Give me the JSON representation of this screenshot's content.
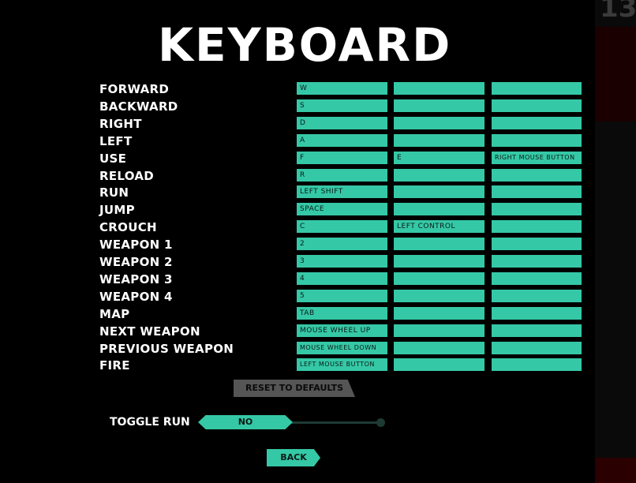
{
  "title": "KEYBOARD",
  "bindings": [
    {
      "action": "FORWARD",
      "keys": [
        "W",
        "",
        ""
      ]
    },
    {
      "action": "BACKWARD",
      "keys": [
        "S",
        "",
        ""
      ]
    },
    {
      "action": "RIGHT",
      "keys": [
        "D",
        "",
        ""
      ]
    },
    {
      "action": "LEFT",
      "keys": [
        "A",
        "",
        ""
      ]
    },
    {
      "action": "USE",
      "keys": [
        "F",
        "E",
        "RIGHT MOUSE BUTTON"
      ]
    },
    {
      "action": "RELOAD",
      "keys": [
        "R",
        "",
        ""
      ]
    },
    {
      "action": "RUN",
      "keys": [
        "LEFT SHIFT",
        "",
        ""
      ]
    },
    {
      "action": "JUMP",
      "keys": [
        "SPACE",
        "",
        ""
      ]
    },
    {
      "action": "CROUCH",
      "keys": [
        "C",
        "LEFT CONTROL",
        ""
      ]
    },
    {
      "action": "WEAPON 1",
      "keys": [
        "2",
        "",
        ""
      ]
    },
    {
      "action": "WEAPON 2",
      "keys": [
        "3",
        "",
        ""
      ]
    },
    {
      "action": "WEAPON 3",
      "keys": [
        "4",
        "",
        ""
      ]
    },
    {
      "action": "WEAPON 4",
      "keys": [
        "5",
        "",
        ""
      ]
    },
    {
      "action": "MAP",
      "keys": [
        "TAB",
        "",
        ""
      ]
    },
    {
      "action": "NEXT WEAPON",
      "keys": [
        "MOUSE WHEEL UP",
        "",
        ""
      ]
    },
    {
      "action": "PREVIOUS WEAPON",
      "keys": [
        "MOUSE WHEEL DOWN",
        "",
        ""
      ]
    },
    {
      "action": "FIRE",
      "keys": [
        "LEFT MOUSE BUTTON",
        "",
        ""
      ]
    }
  ],
  "reset_label": "RESET TO DEFAULTS",
  "toggle_run": {
    "label": "TOGGLE RUN",
    "value": "NO"
  },
  "back_label": "BACK",
  "corner_number": "13",
  "colors": {
    "accent": "#35c8a6",
    "background": "#000000",
    "disabled": "#555555"
  }
}
